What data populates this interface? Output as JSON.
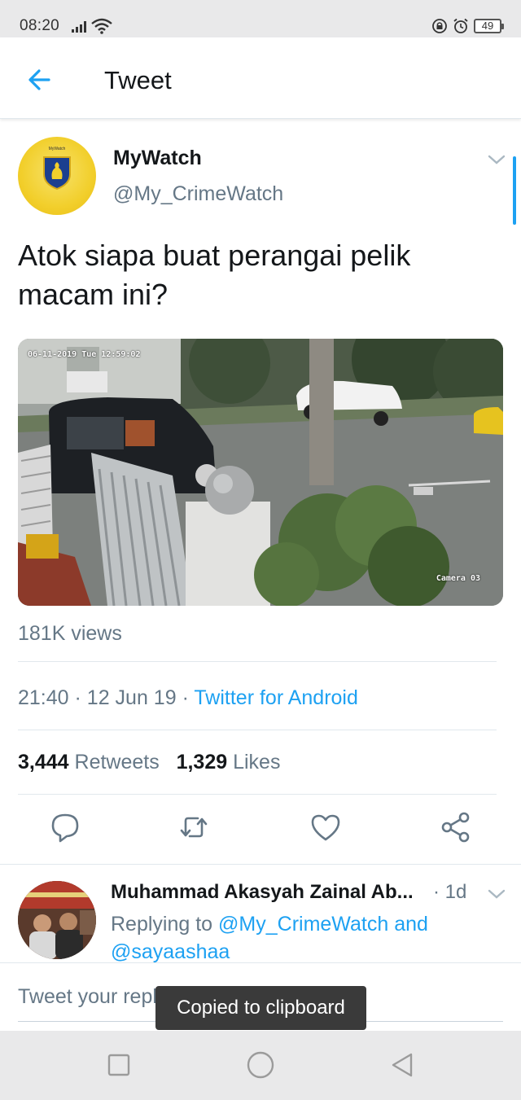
{
  "status_bar": {
    "time": "08:20",
    "battery": "49"
  },
  "app_bar": {
    "title": "Tweet",
    "back_icon": "arrow-left-icon"
  },
  "tweet": {
    "author_name": "MyWatch",
    "author_handle": "@My_CrimeWatch",
    "avatar_text": "MyWatch",
    "text": "Atok siapa buat perangai pelik macam ini?",
    "media": {
      "timestamp_overlay": "06-11-2019 Tue 12:59:02",
      "camera_label": "Camera 03"
    },
    "views": "181K views",
    "time": "21:40",
    "date": "12 Jun 19",
    "separator": "·",
    "source": "Twitter for Android",
    "retweets_count": "3,444",
    "retweets_label": "Retweets",
    "likes_count": "1,329",
    "likes_label": "Likes",
    "actions": [
      "reply-icon",
      "retweet-icon",
      "like-icon",
      "share-icon"
    ]
  },
  "reply": {
    "author_name": "Muhammad Akasyah Zainal Ab...",
    "time": "· 1d",
    "replying_prefix": "Replying to",
    "mention_1": "@My_CrimeWatch",
    "joiner": "and",
    "mention_2": "@sayaashaa"
  },
  "compose": {
    "placeholder": "Tweet your reply"
  },
  "toast": {
    "message": "Copied to clipboard"
  },
  "colors": {
    "accent": "#1da1f2",
    "secondary_text": "#657786",
    "primary_text": "#14171a"
  }
}
